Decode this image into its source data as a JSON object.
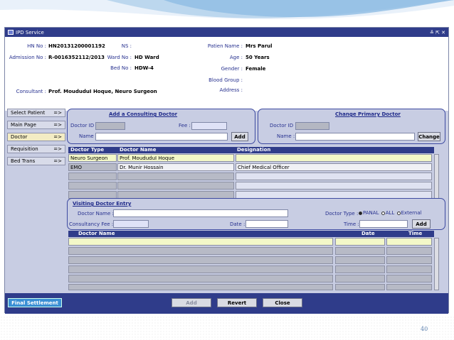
{
  "window": {
    "title": "IPD Service",
    "controls": "≚ ⇱ ✕"
  },
  "patient": {
    "hn_label": "HN No :",
    "hn_value": "HN20131200001192",
    "ns_label": "NS :",
    "admission_label": "Admission No :",
    "admission_value": "R-0016352112/2013",
    "ward_label": "Ward No :",
    "ward_value": "HD Ward",
    "bed_label": "Bed No :",
    "bed_value": "HDW-4",
    "name_label": "Patien Name :",
    "name_value": "Mrs Parul",
    "age_label": "Age :",
    "age_value": "50 Years",
    "gender_label": "Gender :",
    "gender_value": "Female",
    "blood_label": "Blood Group :",
    "address_label": "Address :",
    "consultant_label": "Consultant :",
    "consultant_value": "Prof. MoududuI Hoque, Neuro Surgeon"
  },
  "sidebar": {
    "items": [
      {
        "label": "Select Patient",
        "arrow": "=>"
      },
      {
        "label": "Main Page",
        "arrow": "=>"
      },
      {
        "label": "Doctor",
        "arrow": "=>"
      },
      {
        "label": "Requisition",
        "arrow": "=>"
      },
      {
        "label": "Bed Trans",
        "arrow": "=>"
      }
    ]
  },
  "consulting": {
    "title": "Add a Consulting Doctor",
    "doctor_id_label": "Doctor ID :",
    "fee_label": "Fee :",
    "name_label": "Name :",
    "add_button": "Add"
  },
  "primary": {
    "title": "Change Primary Doctor",
    "doctor_id_label": "Doctor ID :",
    "name_label": "Name :",
    "change_button": "Change"
  },
  "doctor_table": {
    "headers": [
      "Doctor Type",
      "Doctor Name",
      "Designation"
    ],
    "rows": [
      [
        "Neuro Surgeon",
        "Prof. MoududuI Hoque",
        ""
      ],
      [
        "EMO",
        "Dr. Munir Hossain",
        "Chief Medical Officer"
      ],
      [
        "",
        "",
        ""
      ],
      [
        "",
        "",
        ""
      ],
      [
        "",
        "",
        ""
      ]
    ]
  },
  "visiting": {
    "title": "Visiting Doctor Entry",
    "name_label": "Doctor Name :",
    "fee_label": "Consultancy Fee :",
    "date_label": "Date :",
    "type_label": "Doctor Type :",
    "opt_panal": "PANAL",
    "opt_all": "ALL",
    "opt_external": "External",
    "time_label": "Time :",
    "add_button": "Add"
  },
  "visit_table": {
    "headers": [
      "Doctor Name",
      "Date",
      "Time"
    ],
    "rows": 6
  },
  "footer": {
    "final_button": "Final Settlement",
    "add_button": "Add",
    "revert_button": "Revert",
    "close_button": "Close"
  },
  "slide_number": "40"
}
